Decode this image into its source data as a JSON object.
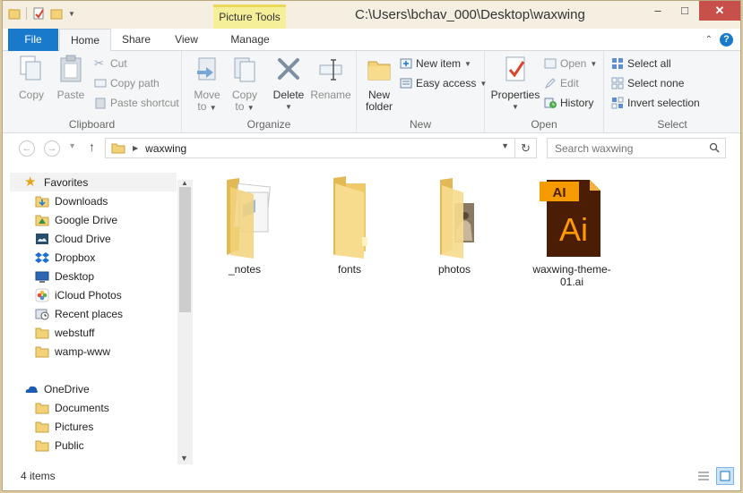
{
  "window": {
    "title": "C:\\Users\\bchav_000\\Desktop\\waxwing",
    "context_tab": "Picture Tools",
    "controls": {
      "minimize": "–",
      "maximize": "□",
      "close": "✕"
    }
  },
  "ribbon_tabs": {
    "file": "File",
    "home": "Home",
    "share": "Share",
    "view": "View",
    "manage": "Manage"
  },
  "ribbon": {
    "clipboard": {
      "label": "Clipboard",
      "copy": "Copy",
      "paste": "Paste",
      "cut": "Cut",
      "copy_path": "Copy path",
      "paste_shortcut": "Paste shortcut"
    },
    "organize": {
      "label": "Organize",
      "move_to_1": "Move",
      "move_to_2": "to",
      "copy_to_1": "Copy",
      "copy_to_2": "to",
      "delete": "Delete",
      "rename": "Rename"
    },
    "new": {
      "label": "New",
      "new_folder_1": "New",
      "new_folder_2": "folder",
      "new_item": "New item",
      "easy_access": "Easy access"
    },
    "open": {
      "label": "Open",
      "properties": "Properties",
      "open": "Open",
      "edit": "Edit",
      "history": "History"
    },
    "select": {
      "label": "Select",
      "select_all": "Select all",
      "select_none": "Select none",
      "invert_selection": "Invert selection"
    }
  },
  "address": {
    "back": "←",
    "forward": "→",
    "recent": "▾",
    "up": "↑",
    "crumb": "waxwing",
    "refresh": "↻",
    "search_placeholder": "Search waxwing"
  },
  "nav_pane": {
    "favorites": "Favorites",
    "favorites_items": [
      {
        "label": "Downloads"
      },
      {
        "label": "Google Drive"
      },
      {
        "label": "Cloud Drive"
      },
      {
        "label": "Dropbox"
      },
      {
        "label": "Desktop"
      },
      {
        "label": "iCloud Photos"
      },
      {
        "label": "Recent places"
      },
      {
        "label": "webstuff"
      },
      {
        "label": "wamp-www"
      }
    ],
    "onedrive": "OneDrive",
    "onedrive_items": [
      {
        "label": "Documents"
      },
      {
        "label": "Pictures"
      },
      {
        "label": "Public"
      }
    ]
  },
  "files": [
    {
      "label": "_notes",
      "type": "folder-docs"
    },
    {
      "label": "fonts",
      "type": "folder"
    },
    {
      "label": "photos",
      "type": "folder-photo"
    },
    {
      "label": "waxwing-theme-01.ai",
      "type": "ai-file"
    }
  ],
  "status": {
    "item_count": "4 items"
  },
  "colors": {
    "accent": "#1979ca",
    "folder": "#f3d27a",
    "ai_bg": "#4b1d05",
    "ai_fg": "#ff9a00",
    "context_tab": "#f6ef9a"
  }
}
